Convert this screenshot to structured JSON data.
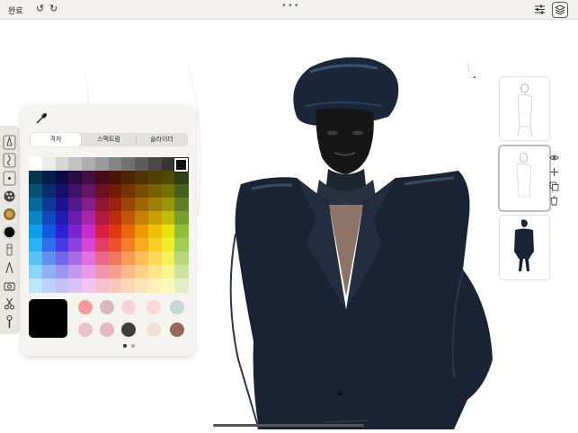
{
  "topbar": {
    "done_label": "완료",
    "undo_glyph": "↺",
    "redo_glyph": "↻",
    "more_glyph": "•••"
  },
  "color_panel": {
    "tabs": [
      {
        "label": "격자",
        "active": true
      },
      {
        "label": "스펙트럼",
        "active": false
      },
      {
        "label": "슬라이더",
        "active": false
      }
    ],
    "current_color": "#000000",
    "history_swatches": [
      "#f29b9b",
      "#d8b9c0",
      "#f5d4d8",
      "#fbd9d9",
      "#c9d5d6",
      "#e9c3c5",
      "#e5b8c7",
      "#3d3d3d",
      "#f0e2d6",
      "#93695e"
    ],
    "page_indicator": {
      "count": 2,
      "active": 0
    }
  },
  "grid_palette": {
    "gray_row": [
      "#ffffff",
      "#ececec",
      "#d6d6d6",
      "#c2c2c2",
      "#aeaeae",
      "#9a9a9a",
      "#858585",
      "#717171",
      "#5d5d5d",
      "#494949",
      "#353535",
      "#111111"
    ],
    "hue_columns": [
      {
        "h": 200,
        "s": 90
      },
      {
        "h": 220,
        "s": 85
      },
      {
        "h": 245,
        "s": 75
      },
      {
        "h": 270,
        "s": 70
      },
      {
        "h": 300,
        "s": 65
      },
      {
        "h": 345,
        "s": 75
      },
      {
        "h": 10,
        "s": 85
      },
      {
        "h": 25,
        "s": 90
      },
      {
        "h": 38,
        "s": 95
      },
      {
        "h": 48,
        "s": 95
      },
      {
        "h": 58,
        "s": 90
      },
      {
        "h": 80,
        "s": 55
      }
    ],
    "lightness_rows": [
      16,
      24,
      32,
      40,
      48,
      56,
      66,
      76,
      86
    ]
  },
  "layers": {
    "count": 3,
    "selected_index": 1
  },
  "colors": {
    "topbar_bg": "#f2f1ef",
    "panel_bg": "#f5f4f1",
    "toolstrip_bg": "#e9e7e2",
    "figure_dark": "#1a2333"
  }
}
